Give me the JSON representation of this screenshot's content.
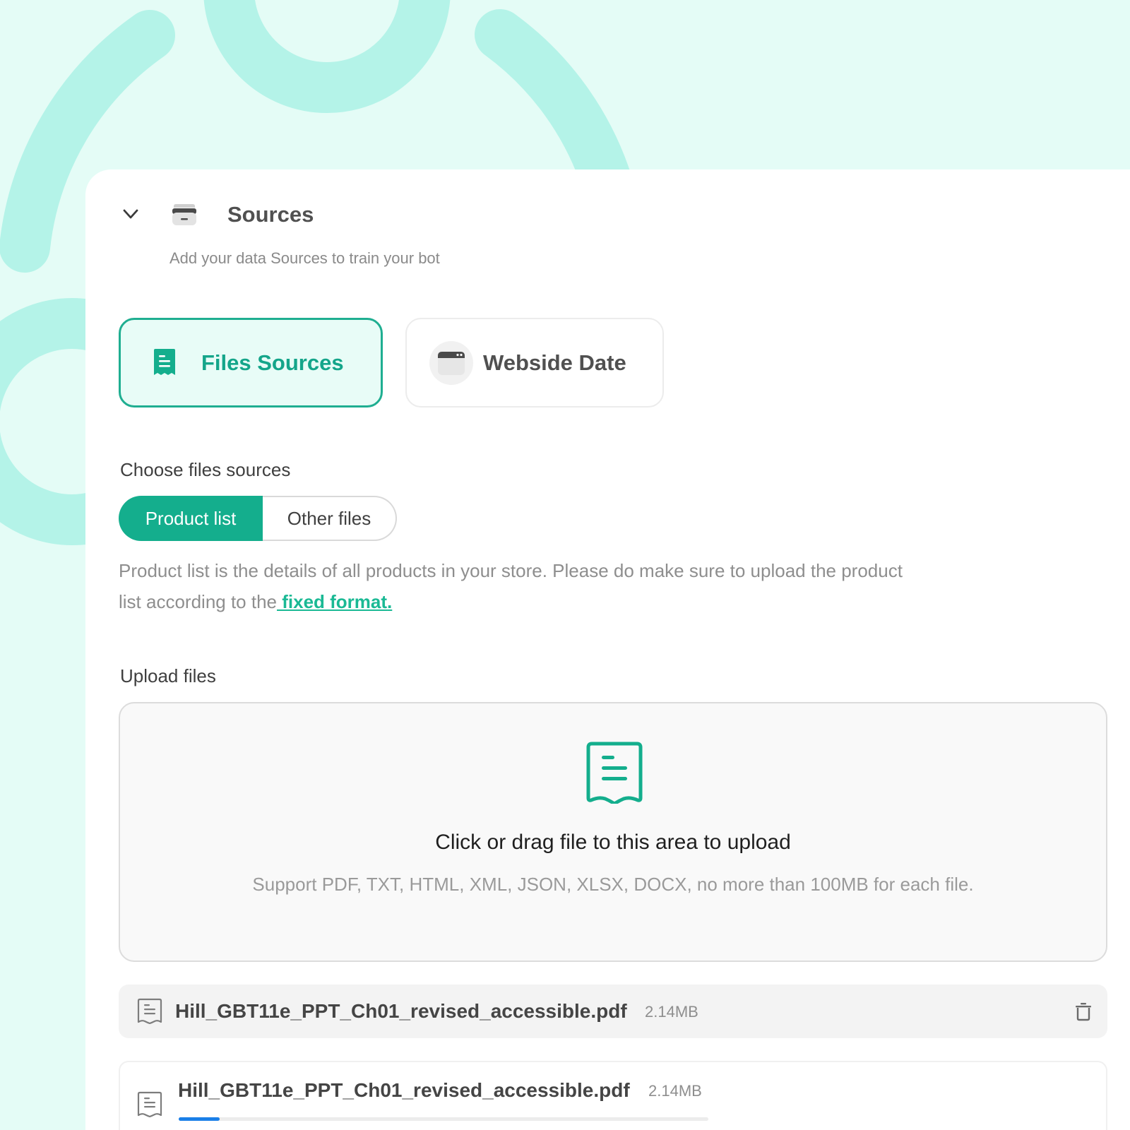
{
  "section": {
    "title": "Sources",
    "subtitle": "Add your data Sources to train your bot"
  },
  "source_tabs": [
    {
      "label": "Files Sources",
      "icon": "file-text-icon",
      "active": true
    },
    {
      "label": "Webside Date",
      "icon": "browser-window-icon",
      "active": false
    }
  ],
  "choose": {
    "label": "Choose files sources",
    "options": [
      "Product list",
      "Other files"
    ],
    "selected": "Product list"
  },
  "description": {
    "text": "Product list is the details of all products in your store. Please do make sure to upload the product list according to the",
    "link": " fixed format",
    "suffix": "."
  },
  "upload": {
    "label": "Upload files",
    "title": "Click or drag file to this area to upload",
    "hint": "Support PDF, TXT, HTML, XML, JSON, XLSX, DOCX, no more than 100MB for each file."
  },
  "files": [
    {
      "name": "Hill_GBT11e_PPT_Ch01_revised_accessible.pdf",
      "size": "2.14MB",
      "status": "uploaded"
    },
    {
      "name": "Hill_GBT11e_PPT_Ch01_revised_accessible.pdf",
      "size": "2.14MB",
      "status": "uploading",
      "progress": 0.077
    }
  ],
  "colors": {
    "accent": "#14ae8d",
    "background": "#e4fcf6",
    "decoration": "#b4f3e8",
    "progress": "#1b7fe8"
  }
}
